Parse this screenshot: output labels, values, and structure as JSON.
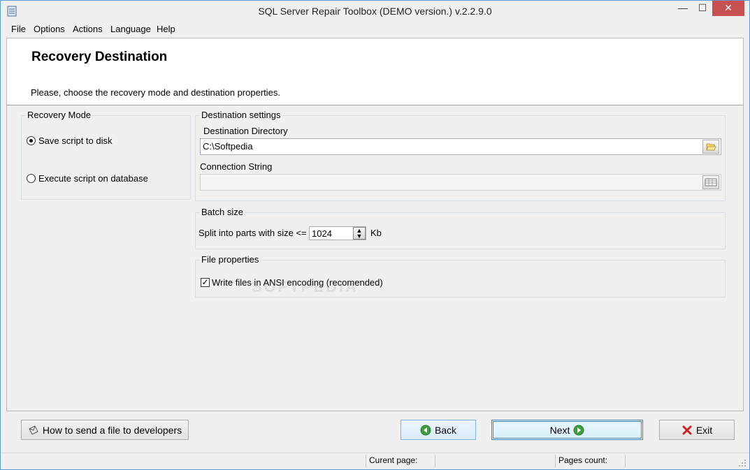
{
  "window": {
    "title": "SQL Server Repair Toolbox (DEMO version.) v.2.2.9.0",
    "controls": {
      "minimize": "—",
      "maximize": "☐",
      "close": "✕"
    }
  },
  "menu": {
    "items": [
      "File",
      "Options",
      "Actions",
      "Language",
      "Help"
    ]
  },
  "header": {
    "title": "Recovery Destination",
    "subtitle": "Please, choose the recovery mode and destination properties."
  },
  "recovery_mode": {
    "title": "Recovery Mode",
    "options": [
      {
        "label": "Save script to disk",
        "checked": true
      },
      {
        "label": "Execute script on database",
        "checked": false
      }
    ]
  },
  "destination": {
    "title": "Destination settings",
    "dir_label": "Destination Directory",
    "dir_value": "C:\\Softpedia",
    "conn_label": "Connection String",
    "conn_value": ""
  },
  "batch": {
    "title": "Batch size",
    "label": "Split into parts with size <=",
    "value": "1024",
    "unit": "Kb"
  },
  "file_props": {
    "title": "File properties",
    "ansi_label": "Write files in ANSI encoding (recomended)",
    "ansi_checked": true
  },
  "watermark": "SOFTPEDIA",
  "buttons": {
    "help": "How to send a file to developers",
    "back": "Back",
    "next": "Next",
    "exit": "Exit"
  },
  "status": {
    "current_page": "Curent page:",
    "pages_count": "Pages count:"
  },
  "icons": {
    "folder": "folder-open-icon",
    "grid": "table-icon",
    "back": "green-left-arrow-icon",
    "next": "green-right-arrow-icon",
    "exit": "red-x-icon",
    "help": "mail-icon"
  }
}
